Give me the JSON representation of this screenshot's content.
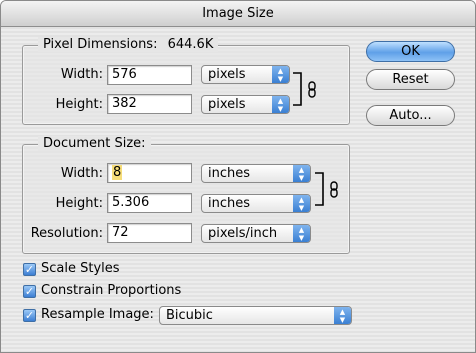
{
  "dialog": {
    "title": "Image Size"
  },
  "pixel_dimensions": {
    "legend": "Pixel Dimensions:",
    "size": "644.6K",
    "width": {
      "label": "Width:",
      "value": "576",
      "unit": "pixels"
    },
    "height": {
      "label": "Height:",
      "value": "382",
      "unit": "pixels"
    }
  },
  "document_size": {
    "legend": "Document Size:",
    "width": {
      "label": "Width:",
      "value": "8",
      "unit": "inches"
    },
    "height": {
      "label": "Height:",
      "value": "5.306",
      "unit": "inches"
    },
    "resolution": {
      "label": "Resolution:",
      "value": "72",
      "unit": "pixels/inch"
    }
  },
  "buttons": {
    "ok": "OK",
    "reset": "Reset",
    "auto": "Auto..."
  },
  "options": {
    "scale_styles": {
      "label": "Scale Styles",
      "checked": true
    },
    "constrain_proportions": {
      "label": "Constrain Proportions",
      "checked": true
    },
    "resample_image": {
      "label": "Resample Image:",
      "checked": true,
      "method": "Bicubic"
    }
  },
  "icons": {
    "chain": "chain-link-icon",
    "check": "checkmark-icon",
    "updown": "updown-arrows-icon"
  }
}
